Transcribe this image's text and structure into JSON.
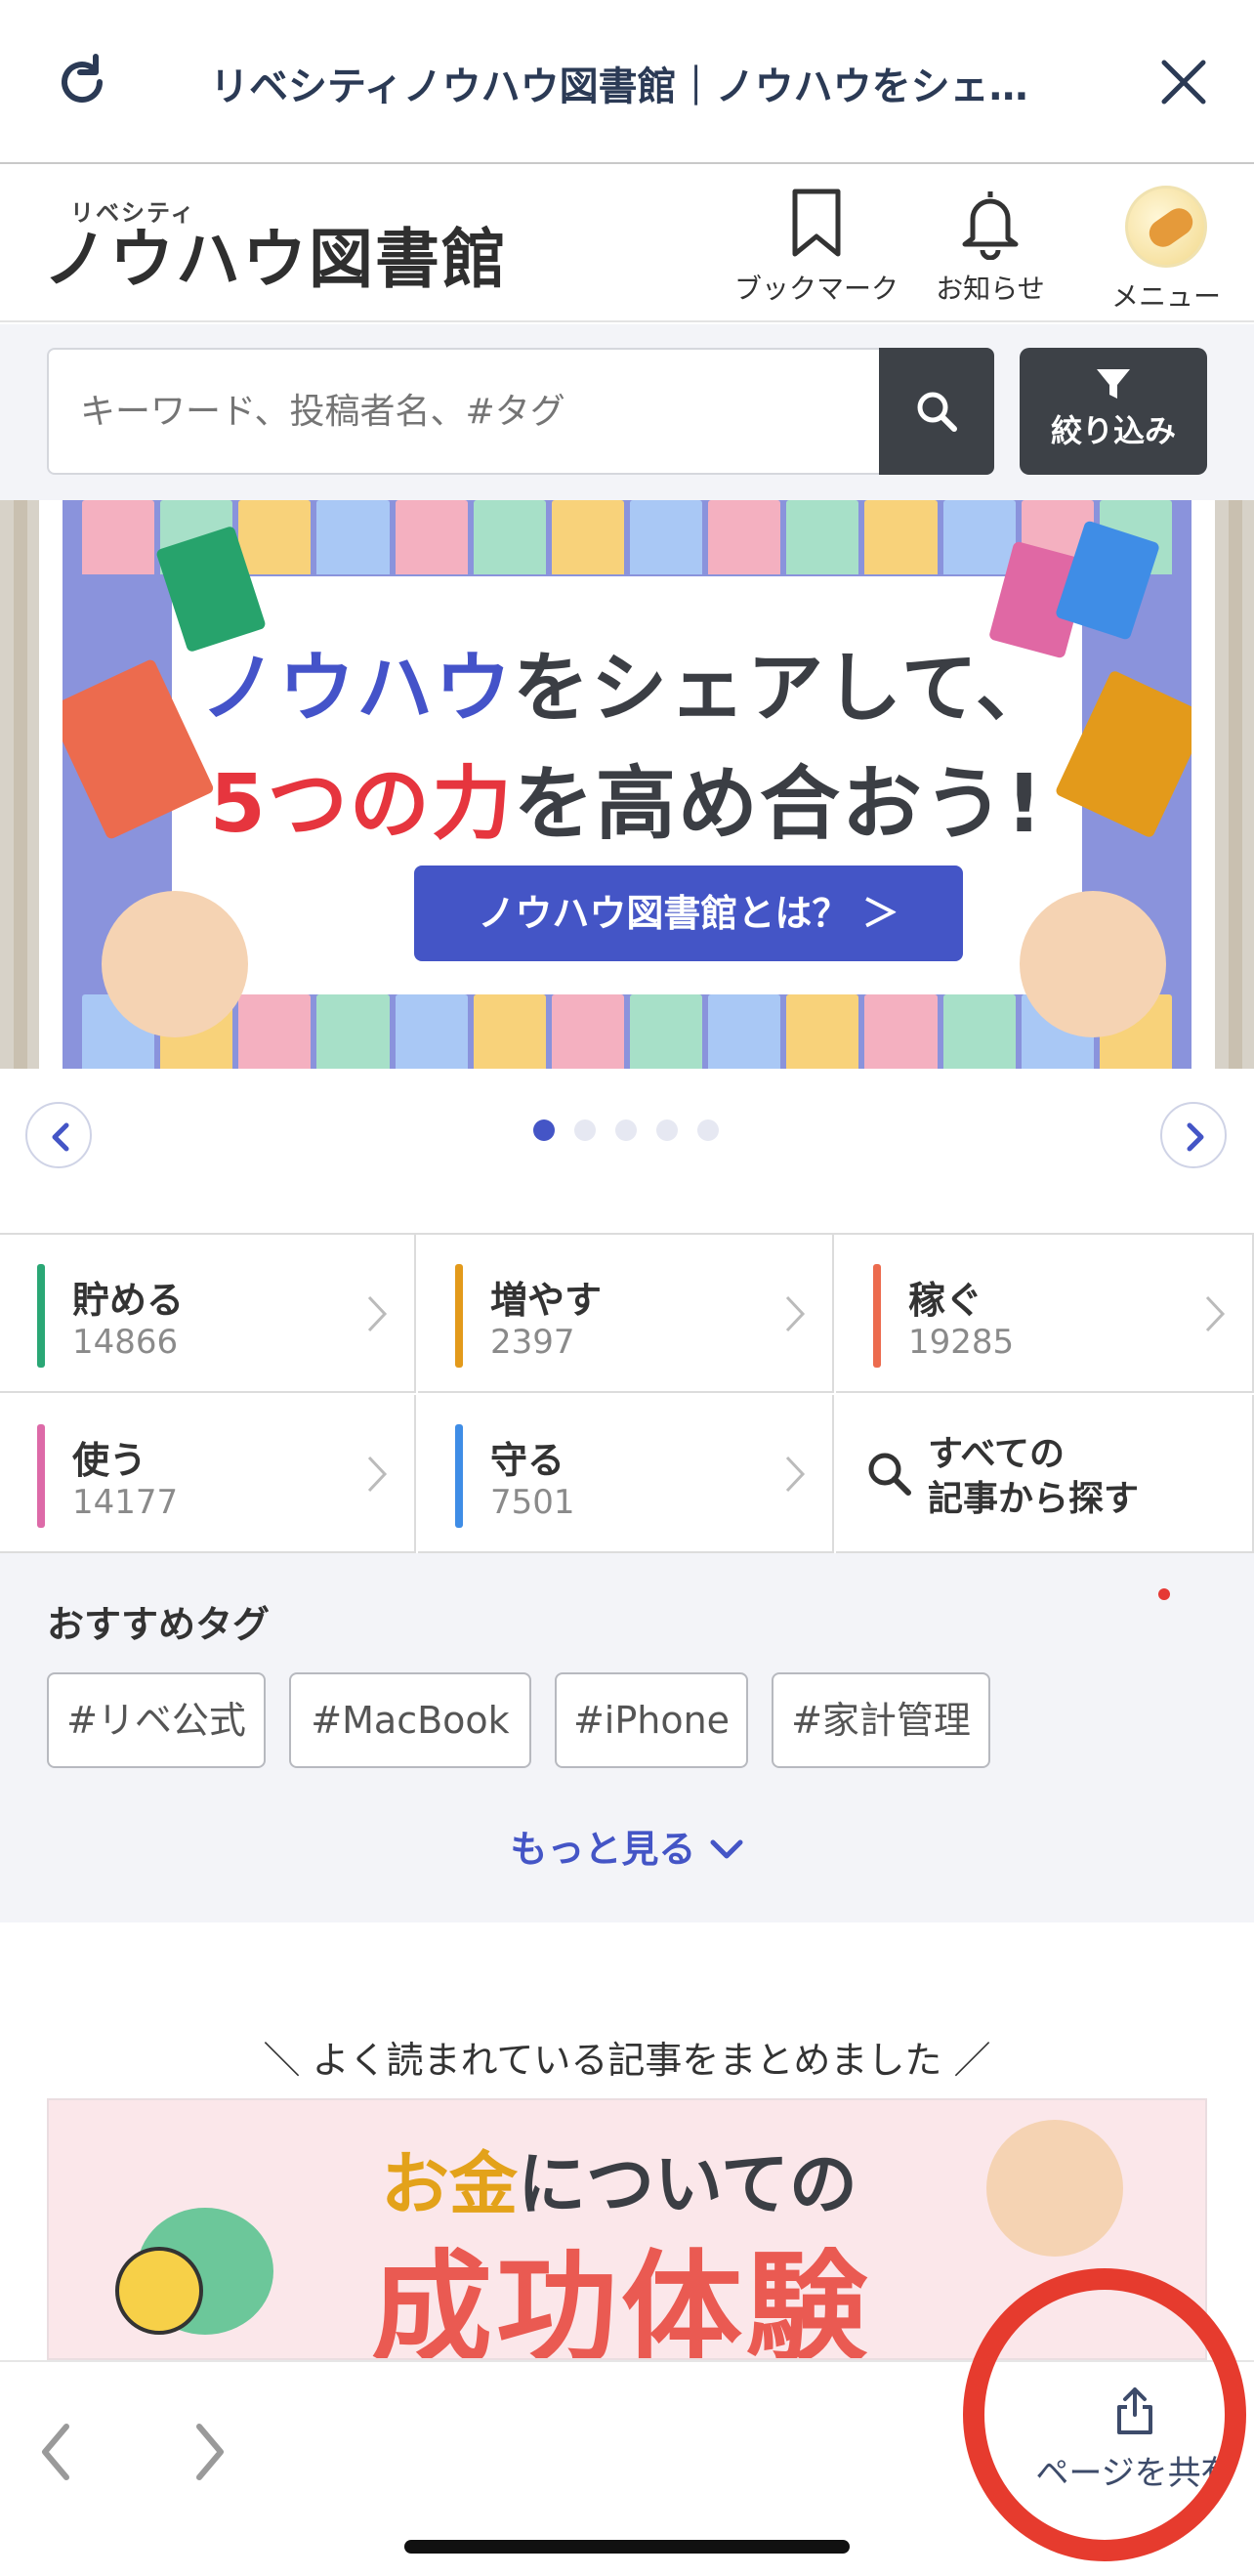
{
  "browser": {
    "title": "リベシティノウハウ図書館｜ノウハウをシェ…",
    "reload_icon": "reload-icon",
    "close_icon": "close-icon"
  },
  "header": {
    "logo_small": "リベシティ",
    "logo_main": "ノウハウ図書館",
    "bookmark_label": "ブックマーク",
    "notify_label": "お知らせ",
    "menu_label": "メニュー"
  },
  "search": {
    "placeholder": "キーワード、投稿者名、#タグ",
    "filter_label": "絞り込み"
  },
  "banner": {
    "line1_blue": "ノウハウ",
    "line1_rest": "をシェアして、",
    "line2_red": "5つの力",
    "line2_rest": "を高め合おう!",
    "cta": "ノウハウ図書館とは？ ＞"
  },
  "carousel": {
    "dot_count": 5,
    "active_index": 0
  },
  "categories": [
    {
      "name": "貯める",
      "count": "14866",
      "color": "#2aa775"
    },
    {
      "name": "増やす",
      "count": "2397",
      "color": "#e39a1b"
    },
    {
      "name": "稼ぐ",
      "count": "19285",
      "color": "#ec6b4e"
    },
    {
      "name": "使う",
      "count": "14177",
      "color": "#dd6aa8"
    },
    {
      "name": "守る",
      "count": "7501",
      "color": "#3f8de6"
    }
  ],
  "search_all": {
    "line1": "すべての",
    "line2": "記事から探す"
  },
  "tags": {
    "title": "おすすめタグ",
    "items": [
      "#リベ公式",
      "#MacBook",
      "#iPhone",
      "#家計管理"
    ],
    "more": "もっと見る"
  },
  "popular": {
    "title": "＼ よく読まれている記事をまとめました ／",
    "banner_line1_gold": "お金",
    "banner_line1_rest": "についての",
    "banner_line2": "成功体験"
  },
  "toolbar": {
    "share_label": "ページを共有"
  },
  "colors": {
    "accent": "#4455c6",
    "dark_button": "#3d4147",
    "annotation_circle": "#e63b2e"
  }
}
